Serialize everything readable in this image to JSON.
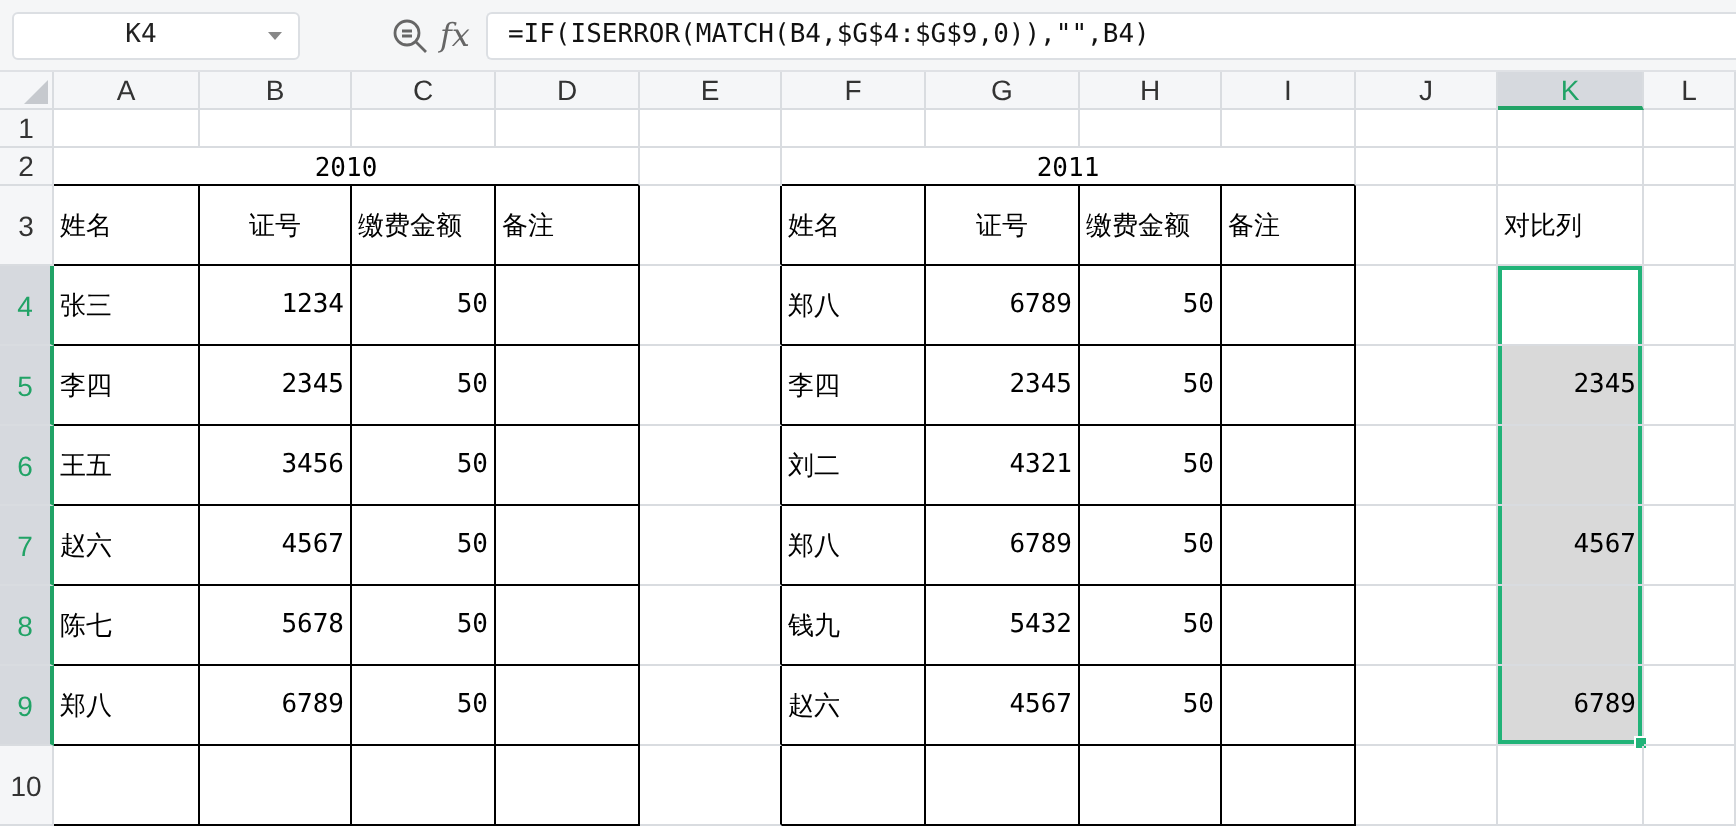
{
  "formula_bar": {
    "name_box": "K4",
    "fx_label": "fx",
    "formula": "=IF(ISERROR(MATCH(B4,$G$4:$G$9,0)),\"\",B4)"
  },
  "sheet": {
    "columns": [
      {
        "label": "A",
        "selected": false
      },
      {
        "label": "B",
        "selected": false
      },
      {
        "label": "C",
        "selected": false
      },
      {
        "label": "D",
        "selected": false
      },
      {
        "label": "E",
        "selected": false
      },
      {
        "label": "F",
        "selected": false
      },
      {
        "label": "G",
        "selected": false
      },
      {
        "label": "H",
        "selected": false
      },
      {
        "label": "I",
        "selected": false
      },
      {
        "label": "J",
        "selected": false
      },
      {
        "label": "K",
        "selected": true
      },
      {
        "label": "L",
        "selected": false
      }
    ],
    "rows": [
      {
        "label": "1",
        "selected": false,
        "cells": [
          null,
          null,
          null,
          null,
          null,
          null,
          null,
          null,
          null,
          null,
          null,
          null
        ]
      },
      {
        "label": "2",
        "selected": false,
        "cells": [
          {
            "text": "2010",
            "kind": "merged",
            "colspan": 4
          },
          null,
          {
            "text": "2011",
            "kind": "merged",
            "colspan": 4
          },
          null,
          null,
          null
        ]
      },
      {
        "label": "3",
        "selected": false,
        "cells": [
          {
            "text": "姓名",
            "kind": "text",
            "bordered": true
          },
          {
            "text": "证号",
            "kind": "center",
            "bordered": true
          },
          {
            "text": "缴费金额",
            "kind": "text",
            "bordered": true
          },
          {
            "text": "备注",
            "kind": "text",
            "bordered": true
          },
          null,
          {
            "text": "姓名",
            "kind": "text",
            "bordered": true
          },
          {
            "text": "证号",
            "kind": "center",
            "bordered": true
          },
          {
            "text": "缴费金额",
            "kind": "text",
            "bordered": true
          },
          {
            "text": "备注",
            "kind": "text",
            "bordered": true
          },
          null,
          {
            "text": "对比列",
            "kind": "text"
          },
          null
        ]
      },
      {
        "label": "4",
        "selected": true,
        "cells": [
          {
            "text": "张三",
            "kind": "text",
            "bordered": true
          },
          {
            "text": "1234",
            "kind": "number",
            "bordered": true
          },
          {
            "text": "50",
            "kind": "number",
            "bordered": true
          },
          {
            "bordered": true
          },
          null,
          {
            "text": "郑八",
            "kind": "text",
            "bordered": true
          },
          {
            "text": "6789",
            "kind": "number",
            "bordered": true
          },
          {
            "text": "50",
            "kind": "number",
            "bordered": true
          },
          {
            "bordered": true
          },
          null,
          {
            "kind": "number",
            "selected": true,
            "active": true
          },
          null
        ]
      },
      {
        "label": "5",
        "selected": true,
        "cells": [
          {
            "text": "李四",
            "kind": "text",
            "bordered": true
          },
          {
            "text": "2345",
            "kind": "number",
            "bordered": true
          },
          {
            "text": "50",
            "kind": "number",
            "bordered": true
          },
          {
            "bordered": true
          },
          null,
          {
            "text": "李四",
            "kind": "text",
            "bordered": true
          },
          {
            "text": "2345",
            "kind": "number",
            "bordered": true
          },
          {
            "text": "50",
            "kind": "number",
            "bordered": true
          },
          {
            "bordered": true
          },
          null,
          {
            "text": "2345",
            "kind": "number",
            "selected": true,
            "active": false
          },
          null
        ]
      },
      {
        "label": "6",
        "selected": true,
        "cells": [
          {
            "text": "王五",
            "kind": "text",
            "bordered": true
          },
          {
            "text": "3456",
            "kind": "number",
            "bordered": true
          },
          {
            "text": "50",
            "kind": "number",
            "bordered": true
          },
          {
            "bordered": true
          },
          null,
          {
            "text": "刘二",
            "kind": "text",
            "bordered": true
          },
          {
            "text": "4321",
            "kind": "number",
            "bordered": true
          },
          {
            "text": "50",
            "kind": "number",
            "bordered": true
          },
          {
            "bordered": true
          },
          null,
          {
            "kind": "number",
            "selected": true,
            "active": false
          },
          null
        ]
      },
      {
        "label": "7",
        "selected": true,
        "cells": [
          {
            "text": "赵六",
            "kind": "text",
            "bordered": true
          },
          {
            "text": "4567",
            "kind": "number",
            "bordered": true
          },
          {
            "text": "50",
            "kind": "number",
            "bordered": true
          },
          {
            "bordered": true
          },
          null,
          {
            "text": "郑八",
            "kind": "text",
            "bordered": true
          },
          {
            "text": "6789",
            "kind": "number",
            "bordered": true
          },
          {
            "text": "50",
            "kind": "number",
            "bordered": true
          },
          {
            "bordered": true
          },
          null,
          {
            "text": "4567",
            "kind": "number",
            "selected": true,
            "active": false
          },
          null
        ]
      },
      {
        "label": "8",
        "selected": true,
        "cells": [
          {
            "text": "陈七",
            "kind": "text",
            "bordered": true
          },
          {
            "text": "5678",
            "kind": "number",
            "bordered": true
          },
          {
            "text": "50",
            "kind": "number",
            "bordered": true
          },
          {
            "bordered": true
          },
          null,
          {
            "text": "钱九",
            "kind": "text",
            "bordered": true
          },
          {
            "text": "5432",
            "kind": "number",
            "bordered": true
          },
          {
            "text": "50",
            "kind": "number",
            "bordered": true
          },
          {
            "bordered": true
          },
          null,
          {
            "kind": "number",
            "selected": true,
            "active": false
          },
          null
        ]
      },
      {
        "label": "9",
        "selected": true,
        "cells": [
          {
            "text": "郑八",
            "kind": "text",
            "bordered": true
          },
          {
            "text": "6789",
            "kind": "number",
            "bordered": true
          },
          {
            "text": "50",
            "kind": "number",
            "bordered": true
          },
          {
            "bordered": true
          },
          null,
          {
            "text": "赵六",
            "kind": "text",
            "bordered": true
          },
          {
            "text": "4567",
            "kind": "number",
            "bordered": true
          },
          {
            "text": "50",
            "kind": "number",
            "bordered": true
          },
          {
            "bordered": true
          },
          null,
          {
            "text": "6789",
            "kind": "number",
            "selected": true,
            "active": false
          },
          null
        ]
      },
      {
        "label": "10",
        "selected": false,
        "cells": [
          {
            "bordered": true
          },
          {
            "bordered": true
          },
          {
            "bordered": true
          },
          {
            "bordered": true
          },
          null,
          {
            "bordered": true
          },
          {
            "bordered": true
          },
          {
            "bordered": true
          },
          {
            "bordered": true
          },
          null,
          null,
          null
        ]
      }
    ]
  }
}
